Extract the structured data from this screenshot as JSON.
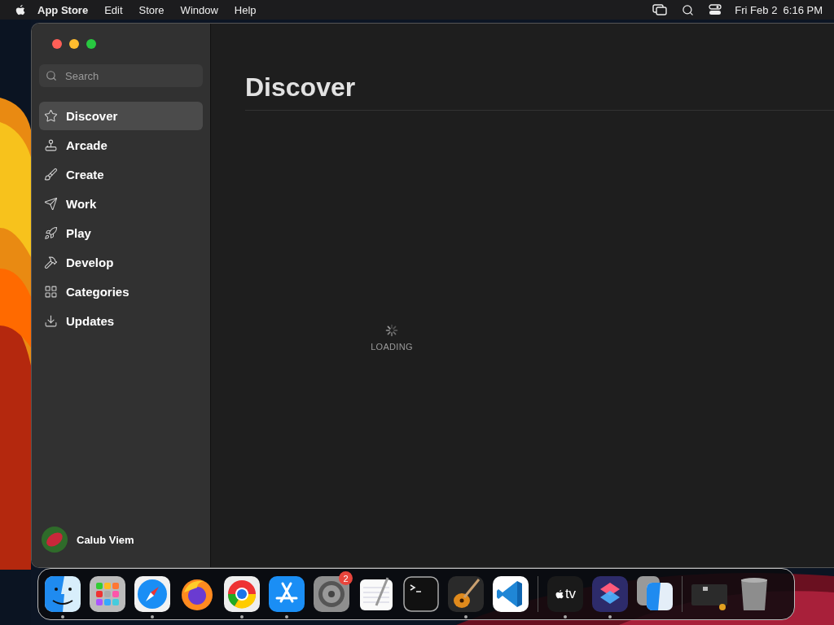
{
  "menu_bar": {
    "app_name": "App Store",
    "menus": [
      "Edit",
      "Store",
      "Window",
      "Help"
    ],
    "clock": "Fri Feb 2  6:16 PM"
  },
  "window": {
    "search": {
      "placeholder": "Search"
    },
    "sidebar": {
      "items": [
        {
          "label": "Discover",
          "kind": "star",
          "selected": true
        },
        {
          "label": "Arcade",
          "kind": "joystick",
          "selected": false
        },
        {
          "label": "Create",
          "kind": "brush",
          "selected": false
        },
        {
          "label": "Work",
          "kind": "plane",
          "selected": false
        },
        {
          "label": "Play",
          "kind": "rocket",
          "selected": false
        },
        {
          "label": "Develop",
          "kind": "hammer",
          "selected": false
        },
        {
          "label": "Categories",
          "kind": "grid",
          "selected": false
        },
        {
          "label": "Updates",
          "kind": "download",
          "selected": false
        }
      ]
    },
    "account": {
      "name": "Calub Viem"
    },
    "main": {
      "title": "Discover",
      "status": "LOADING"
    }
  },
  "dock": {
    "items": [
      {
        "kind": "finder",
        "running": true
      },
      {
        "kind": "launchpad",
        "running": false
      },
      {
        "kind": "safari",
        "running": true
      },
      {
        "kind": "firefox",
        "running": false
      },
      {
        "kind": "chrome",
        "running": true
      },
      {
        "kind": "appstore",
        "running": true
      },
      {
        "kind": "settings",
        "running": false,
        "badge": "2"
      },
      {
        "kind": "textedit",
        "running": false
      },
      {
        "kind": "terminal",
        "running": false
      },
      {
        "kind": "guitar",
        "running": true
      },
      {
        "kind": "vscode",
        "running": false
      },
      {
        "kind": "separator"
      },
      {
        "kind": "tv",
        "running": true,
        "label": "tv"
      },
      {
        "kind": "shortcuts",
        "running": true
      },
      {
        "kind": "migration",
        "running": false
      },
      {
        "kind": "separator"
      },
      {
        "kind": "minimized",
        "running": false
      },
      {
        "kind": "trash",
        "running": false
      }
    ]
  }
}
